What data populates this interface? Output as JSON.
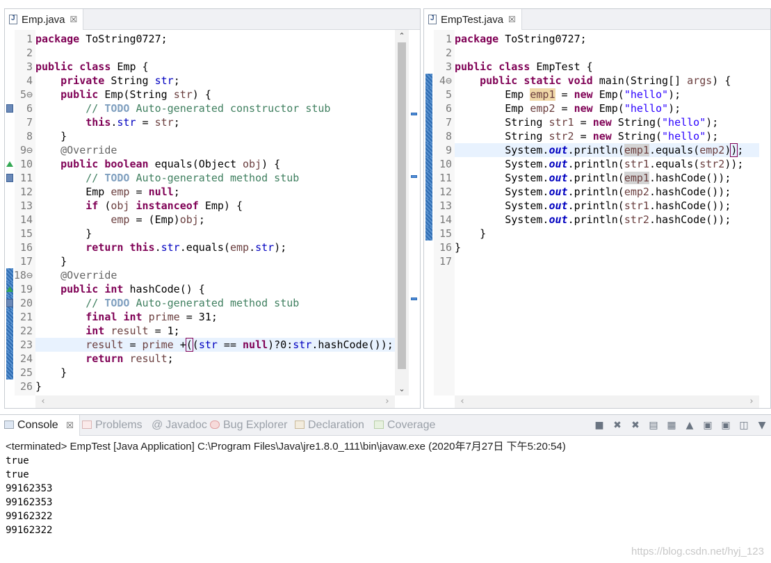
{
  "left_editor": {
    "tab": {
      "label": "Emp.java",
      "close": "☒"
    },
    "current_line": 23,
    "lines": [
      {
        "n": 1,
        "html": "<span class=\"kw\">package</span> ToString0727;"
      },
      {
        "n": 2,
        "html": ""
      },
      {
        "n": 3,
        "html": "<span class=\"kw\">public</span> <span class=\"kw\">class</span> Emp {"
      },
      {
        "n": 4,
        "html": "    <span class=\"kw\">private</span> String <span class=\"fld\">str</span>;"
      },
      {
        "n": 5,
        "html": "    <span class=\"kw\">public</span> Emp(String <span class=\"var\">str</span>) {",
        "fold": true
      },
      {
        "n": 6,
        "html": "        <span class=\"cmt\">// <span class=\"todo\">TODO</span> Auto-generated constructor stub</span>"
      },
      {
        "n": 7,
        "html": "        <span class=\"kw\">this</span>.<span class=\"fld\">str</span> = <span class=\"var\">str</span>;"
      },
      {
        "n": 8,
        "html": "    }"
      },
      {
        "n": 9,
        "html": "    <span class=\"ann\">@Override</span>",
        "fold": true
      },
      {
        "n": 10,
        "html": "    <span class=\"kw\">public</span> <span class=\"kw\">boolean</span> equals(Object <span class=\"var\">obj</span>) {"
      },
      {
        "n": 11,
        "html": "        <span class=\"cmt\">// <span class=\"todo\">TODO</span> Auto-generated method stub</span>"
      },
      {
        "n": 12,
        "html": "        Emp <span class=\"var\">emp</span> = <span class=\"kw\">null</span>;"
      },
      {
        "n": 13,
        "html": "        <span class=\"kw\">if</span> (<span class=\"var\">obj</span> <span class=\"kw\">instanceof</span> Emp) {"
      },
      {
        "n": 14,
        "html": "            <span class=\"var\">emp</span> = (Emp)<span class=\"var\">obj</span>;"
      },
      {
        "n": 15,
        "html": "        }"
      },
      {
        "n": 16,
        "html": "        <span class=\"kw\">return</span> <span class=\"kw\">this</span>.<span class=\"fld\">str</span>.equals(<span class=\"var\">emp</span>.<span class=\"fld\">str</span>);"
      },
      {
        "n": 17,
        "html": "    }"
      },
      {
        "n": 18,
        "html": "    <span class=\"ann\">@Override</span>",
        "fold": true
      },
      {
        "n": 19,
        "html": "    <span class=\"kw\">public</span> <span class=\"kw\">int</span> hashCode() {"
      },
      {
        "n": 20,
        "html": "        <span class=\"cmt\">// <span class=\"todo\">TODO</span> Auto-generated method stub</span>"
      },
      {
        "n": 21,
        "html": "        <span class=\"kw\">final</span> <span class=\"kw\">int</span> <span class=\"var\">prime</span> = 31;"
      },
      {
        "n": 22,
        "html": "        <span class=\"kw\">int</span> <span class=\"var\">result</span> = 1;"
      },
      {
        "n": 23,
        "html": "        <span class=\"var\">result</span> = <span class=\"var\">prime</span> +<span class=\"brk\">(</span>(<span class=\"fld\">str</span> == <span class=\"kw\">null</span>)?0:<span class=\"fld\">str</span>.hashCode());"
      },
      {
        "n": 24,
        "html": "        <span class=\"kw\">return</span> <span class=\"var\">result</span>;"
      },
      {
        "n": 25,
        "html": "    }"
      },
      {
        "n": 26,
        "html": "}"
      }
    ]
  },
  "right_editor": {
    "tab": {
      "label": "EmpTest.java",
      "close": "☒"
    },
    "current_line": 9,
    "lines": [
      {
        "n": 1,
        "html": "<span class=\"kw\">package</span> ToString0727;"
      },
      {
        "n": 2,
        "html": ""
      },
      {
        "n": 3,
        "html": "<span class=\"kw\">public</span> <span class=\"kw\">class</span> EmpTest {"
      },
      {
        "n": 4,
        "html": "    <span class=\"kw\">public</span> <span class=\"kw\">static</span> <span class=\"kw\">void</span> main(String[] <span class=\"var\">args</span>) {",
        "fold": true
      },
      {
        "n": 5,
        "html": "        Emp <span class=\"var occw\">emp1</span> = <span class=\"kw\">new</span> Emp(<span class=\"str\">\"hello\"</span>);"
      },
      {
        "n": 6,
        "html": "        Emp <span class=\"var\">emp2</span> = <span class=\"kw\">new</span> Emp(<span class=\"str\">\"hello\"</span>);"
      },
      {
        "n": 7,
        "html": "        String <span class=\"var\">str1</span> = <span class=\"kw\">new</span> String(<span class=\"str\">\"hello\"</span>);"
      },
      {
        "n": 8,
        "html": "        String <span class=\"var\">str2</span> = <span class=\"kw\">new</span> String(<span class=\"str\">\"hello\"</span>);"
      },
      {
        "n": 9,
        "html": "        System.<span class=\"stat\">out</span>.println(<span class=\"var occ\">emp1</span>.equals(<span class=\"var\">emp2</span>)<span class=\"brk\">)</span>;"
      },
      {
        "n": 10,
        "html": "        System.<span class=\"stat\">out</span>.println(<span class=\"var\">str1</span>.equals(<span class=\"var\">str2</span>));"
      },
      {
        "n": 11,
        "html": "        System.<span class=\"stat\">out</span>.println(<span class=\"var occ\">emp1</span>.hashCode());"
      },
      {
        "n": 12,
        "html": "        System.<span class=\"stat\">out</span>.println(<span class=\"var\">emp2</span>.hashCode());"
      },
      {
        "n": 13,
        "html": "        System.<span class=\"stat\">out</span>.println(<span class=\"var\">str1</span>.hashCode());"
      },
      {
        "n": 14,
        "html": "        System.<span class=\"stat\">out</span>.println(<span class=\"var\">str2</span>.hashCode());"
      },
      {
        "n": 15,
        "html": "    }"
      },
      {
        "n": 16,
        "html": "}"
      },
      {
        "n": 17,
        "html": ""
      }
    ]
  },
  "console": {
    "tabs": [
      "Console",
      "Problems",
      "Javadoc",
      "Bug Explorer",
      "Declaration",
      "Coverage"
    ],
    "close": "☒",
    "status": "<terminated> EmpTest [Java Application] C:\\Program Files\\Java\\jre1.8.0_111\\bin\\javaw.exe (2020年7月27日 下午5:20:54)",
    "output": [
      "true",
      "true",
      "99162353",
      "99162353",
      "99162322",
      "99162322"
    ],
    "toolbar_icons": [
      "terminate-icon",
      "remove-launch-icon",
      "remove-all-icon",
      "scroll-lock-icon",
      "word-wrap-icon",
      "pin-icon",
      "show-on-out-icon",
      "show-on-err-icon",
      "display-console-icon",
      "open-console-icon"
    ]
  },
  "watermark": "https://blog.csdn.net/hyj_123"
}
